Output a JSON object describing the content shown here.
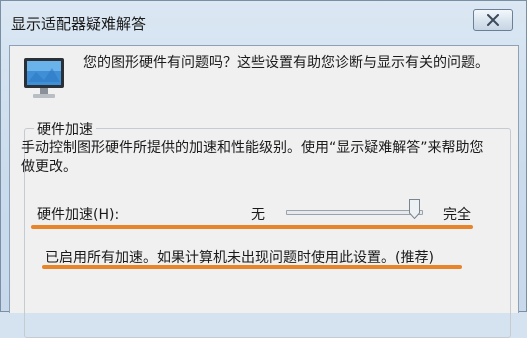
{
  "window": {
    "title": "显示适配器疑难解答"
  },
  "header": {
    "description": "您的图形硬件有问题吗？这些设置有助您诊断与显示有关的问题。"
  },
  "hardware_acceleration": {
    "group_title": "硬件加速",
    "description": "手动控制图形硬件所提供的加速和性能级别。使用“显示疑难解答”来帮助您做更改。",
    "slider_label": "硬件加速(H):",
    "slider_min_label": "无",
    "slider_max_label": "完全",
    "slider_value_fraction": 0.95,
    "status_text": "已启用所有加速。如果计算机未出现问题时使用此设置。(推荐)"
  },
  "colors": {
    "annotation_underline": "#e8852b"
  },
  "icons": {
    "close": "close-icon",
    "monitor": "monitor-icon"
  }
}
